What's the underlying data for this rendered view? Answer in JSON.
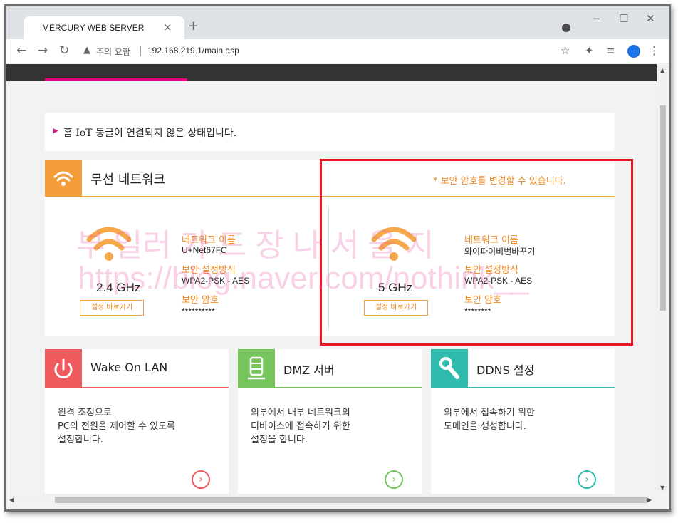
{
  "browser": {
    "tab_title": "MERCURY WEB SERVER",
    "tab_close": "×",
    "new_tab": "+",
    "warning_label": "주의 요함",
    "url": "192.168.219.1/main.asp",
    "window_controls": {
      "minimize": "−",
      "maximize": "☐",
      "close": "✕"
    }
  },
  "notice": {
    "text": "홈 IoT 동글이 연결되지 않은 상태입니다."
  },
  "wireless": {
    "title": "무선 네트워크",
    "note": "* 보안 암호를 변경할 수 있습니다.",
    "bands": [
      {
        "freq": "2.4 GHz",
        "link": "설정 바로가기",
        "network_name_label": "네트워크 이름",
        "network_name": "U+Net67FC",
        "security_label": "보안 설정방식",
        "security": "WPA2-PSK - AES",
        "password_label": "보안 암호",
        "password": "**********"
      },
      {
        "freq": "5 GHz",
        "link": "설정 바로가기",
        "network_name_label": "네트워크 이름",
        "network_name": "와이파이비번바꾸기",
        "security_label": "보안 설정방식",
        "security": "WPA2-PSK - AES",
        "password_label": "보안 암호",
        "password": "********"
      }
    ]
  },
  "watermark": {
    "line1": "부 일러 가 드 장 나 서 울 지",
    "line2": "https://blog.naver.com/nothink__"
  },
  "tiles": [
    {
      "title": "Wake On LAN",
      "desc": [
        "원격 조정으로",
        "PC의 전원을 제어할 수 있도록",
        "설정합니다."
      ],
      "color": "#ef5a5f",
      "icon": "power-icon"
    },
    {
      "title": "DMZ 서버",
      "desc": [
        "외부에서 내부 네트워크의",
        "디바이스에 접속하기 위한",
        "설정을 합니다."
      ],
      "color": "#76c45b",
      "icon": "database-icon"
    },
    {
      "title": "DDNS 설정",
      "desc": [
        "외부에서 접속하기 위한",
        "도메인을 생성합니다."
      ],
      "color": "#2fbcae",
      "icon": "wrench-icon"
    }
  ],
  "colors": {
    "accent_orange": "#f39c38",
    "highlight_red": "#e8181e",
    "active_tab_pink": "#e6007e"
  }
}
